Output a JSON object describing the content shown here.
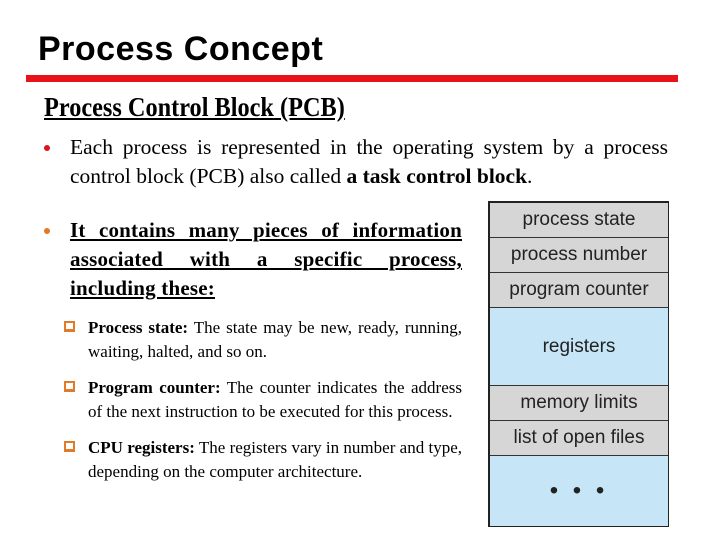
{
  "slide": {
    "title": "Process Concept",
    "subtitle": "Process Control Block (PCB)",
    "bullets": [
      {
        "text_plain": "Each process is represented in the operating system by a process control block (PCB) also called ",
        "text_bold": "a task control block",
        "text_end": "."
      },
      {
        "text": "It contains many pieces of information associated with a specific process, including these:"
      }
    ],
    "subitems": [
      {
        "label": "Process state:",
        "text": " The state may be new, ready, running, waiting, halted, and so on."
      },
      {
        "label": "Program counter:",
        "text": " The counter indicates the address of the next instruction to be executed for this process."
      },
      {
        "label": "CPU registers:",
        "text": " The registers vary in number and type, depending on the computer architecture."
      }
    ]
  },
  "pcb_diagram": {
    "rows": [
      {
        "label": "process state",
        "color": "#d6d6d6"
      },
      {
        "label": "process number",
        "color": "#d6d6d6"
      },
      {
        "label": "program counter",
        "color": "#d6d6d6"
      },
      {
        "label": "registers",
        "color": "#c6e6f7"
      },
      {
        "label": "memory limits",
        "color": "#d6d6d6"
      },
      {
        "label": "list of open files",
        "color": "#d6d6d6"
      },
      {
        "label": "• • •",
        "color": "#c6e6f7"
      }
    ]
  },
  "colors": {
    "rule": "#e8131a",
    "bullet_primary": "#d9161c",
    "bullet_secondary": "#e87722"
  }
}
